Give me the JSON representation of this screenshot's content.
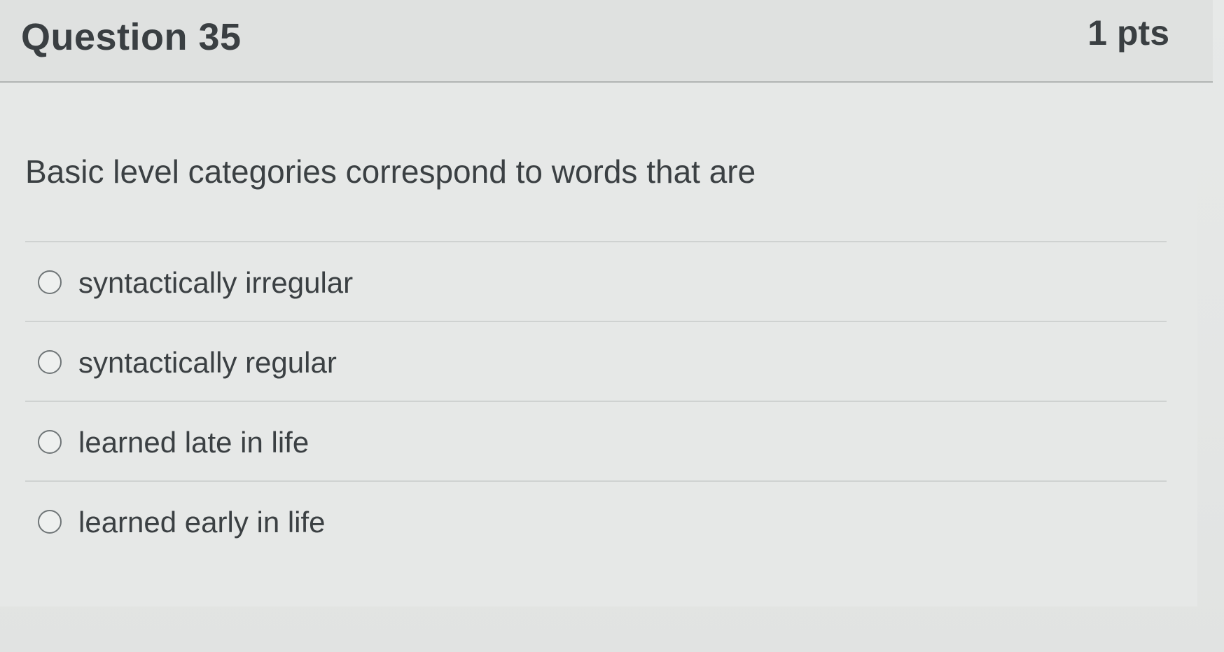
{
  "question": {
    "title": "Question 35",
    "points": "1 pts",
    "text": "Basic level categories correspond to words that are",
    "answers": [
      {
        "label": "syntactically irregular",
        "selected": false
      },
      {
        "label": "syntactically regular",
        "selected": false
      },
      {
        "label": "learned late in life",
        "selected": false
      },
      {
        "label": "learned early in life",
        "selected": false
      }
    ]
  }
}
